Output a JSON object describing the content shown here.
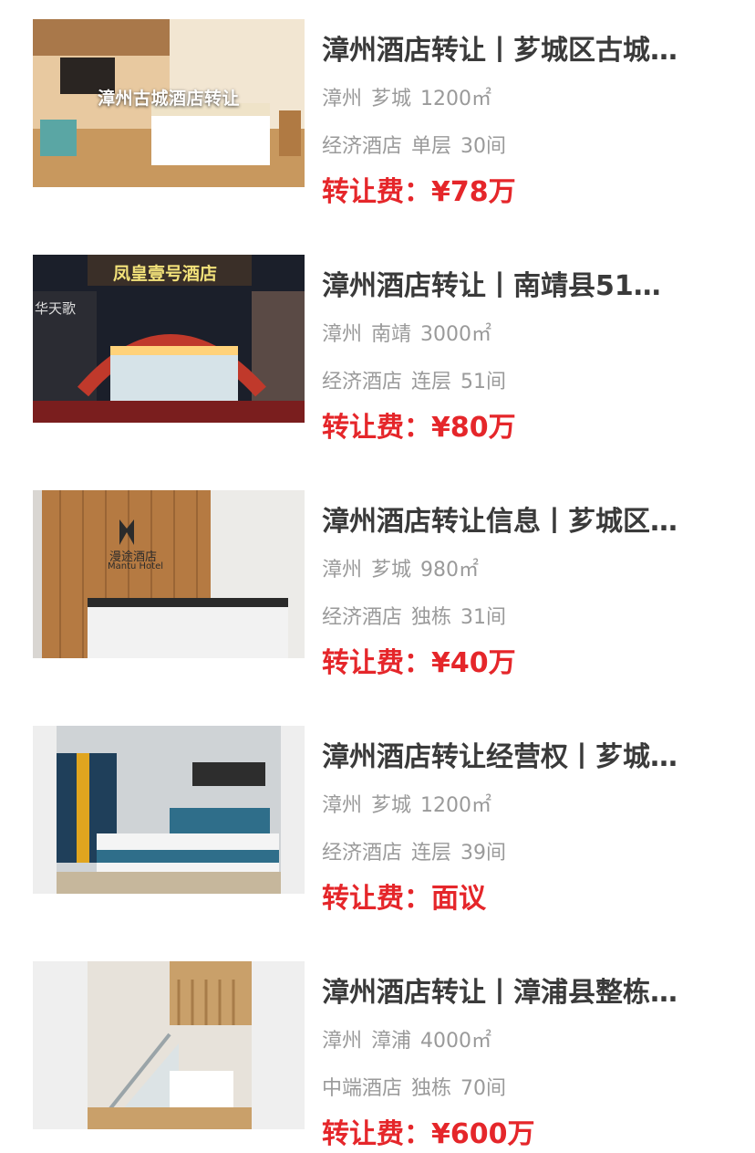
{
  "listings": [
    {
      "title": "漳州酒店转让丨芗城区古城…",
      "image_caption": "漳州古城酒店转让",
      "city": "漳州",
      "district": "芗城",
      "area": "1200㎡",
      "hotel_type": "经济酒店",
      "floor_type": "单层",
      "rooms": "30间",
      "fee_label": "转让费：",
      "fee_value": "¥78万"
    },
    {
      "title": "漳州酒店转让丨南靖县51…",
      "image_sign": "凤皇壹号酒店",
      "image_sign_side": "华天歌",
      "city": "漳州",
      "district": "南靖",
      "area": "3000㎡",
      "hotel_type": "经济酒店",
      "floor_type": "连层",
      "rooms": "51间",
      "fee_label": "转让费：",
      "fee_value": "¥80万"
    },
    {
      "title": "漳州酒店转让信息丨芗城区…",
      "image_sign": "漫途酒店",
      "image_sign_en": "Mantu Hotel",
      "city": "漳州",
      "district": "芗城",
      "area": "980㎡",
      "hotel_type": "经济酒店",
      "floor_type": "独栋",
      "rooms": "31间",
      "fee_label": "转让费：",
      "fee_value": "¥40万"
    },
    {
      "title": "漳州酒店转让经营权丨芗城…",
      "city": "漳州",
      "district": "芗城",
      "area": "1200㎡",
      "hotel_type": "经济酒店",
      "floor_type": "连层",
      "rooms": "39间",
      "fee_label": "转让费：",
      "fee_value": "面议"
    },
    {
      "title": "漳州酒店转让丨漳浦县整栋…",
      "city": "漳州",
      "district": "漳浦",
      "area": "4000㎡",
      "hotel_type": "中端酒店",
      "floor_type": "独栋",
      "rooms": "70间",
      "fee_label": "转让费：",
      "fee_value": "¥600万"
    }
  ],
  "colors": {
    "title": "#3a3a3a",
    "meta": "#9a9a9a",
    "price": "#e5262a"
  }
}
